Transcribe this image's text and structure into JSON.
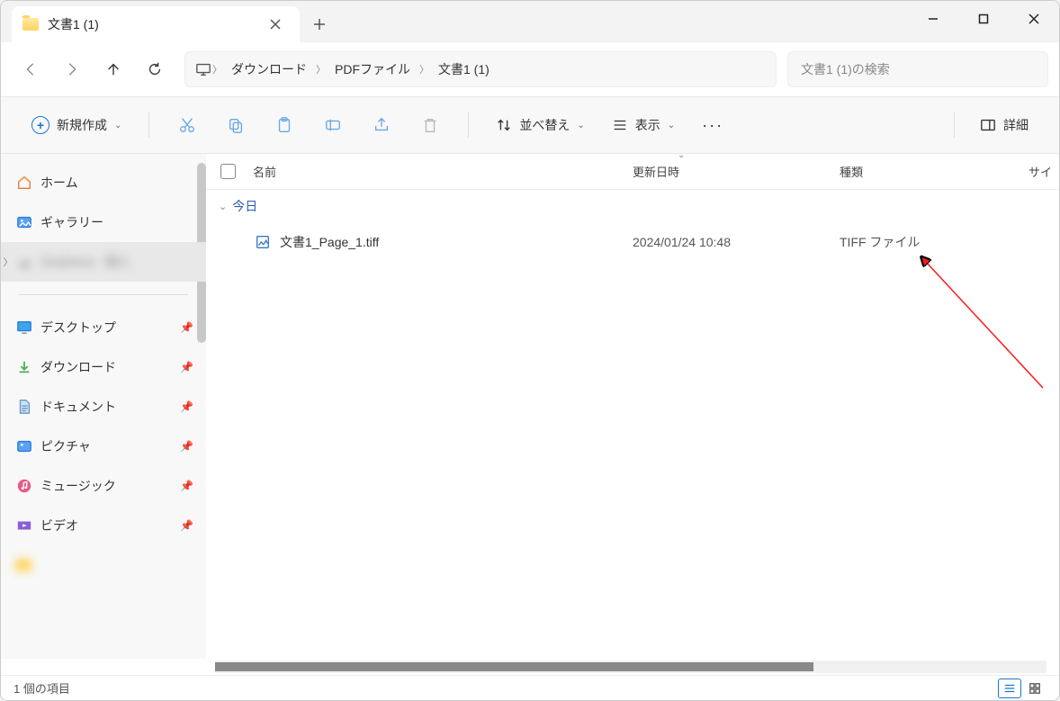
{
  "tab": {
    "title": "文書1 (1)"
  },
  "breadcrumb": {
    "items": [
      "ダウンロード",
      "PDFファイル",
      "文書1 (1)"
    ]
  },
  "search": {
    "placeholder": "文書1 (1)の検索"
  },
  "toolbar": {
    "new_label": "新規作成",
    "sort_label": "並べ替え",
    "view_label": "表示",
    "details_label": "詳細"
  },
  "sidebar": {
    "home": "ホーム",
    "gallery": "ギャラリー",
    "hidden": "OneDrive - 個人",
    "desktop": "デスクトップ",
    "downloads": "ダウンロード",
    "documents": "ドキュメント",
    "pictures": "ピクチャ",
    "music": "ミュージック",
    "videos": "ビデオ"
  },
  "columns": {
    "name": "名前",
    "date": "更新日時",
    "type": "種類",
    "size": "サイ"
  },
  "group": {
    "today": "今日"
  },
  "files": [
    {
      "name": "文書1_Page_1.tiff",
      "date": "2024/01/24 10:48",
      "type": "TIFF ファイル"
    }
  ],
  "status": {
    "count": "1 個の項目"
  }
}
